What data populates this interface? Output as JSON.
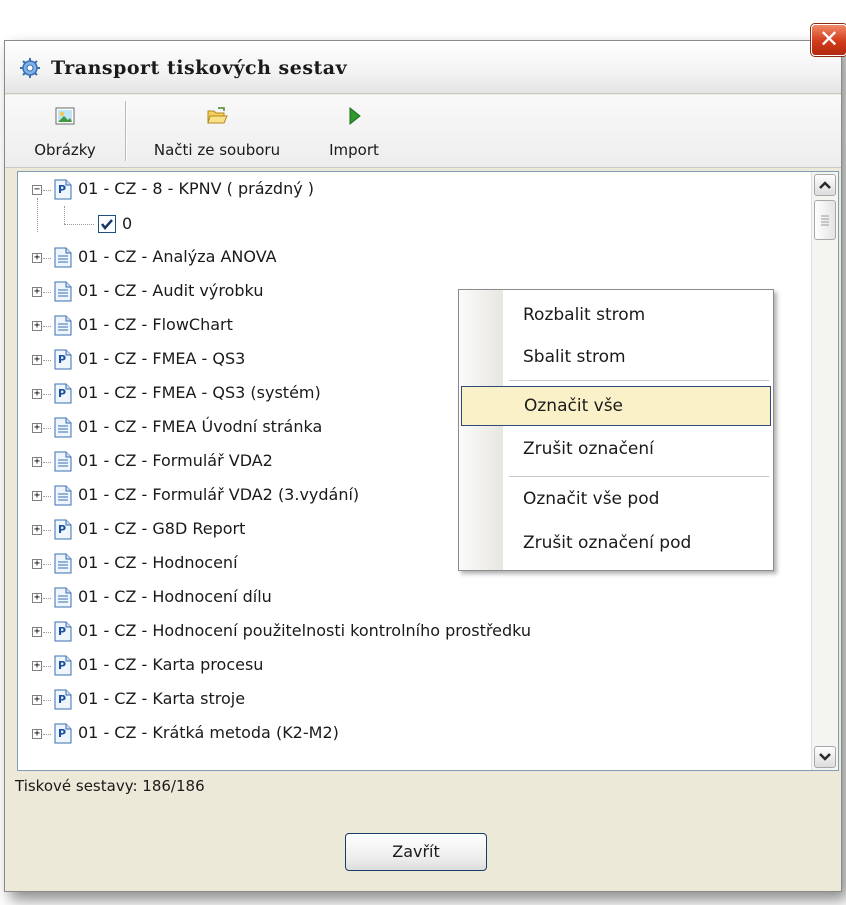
{
  "window": {
    "title": "Transport tiskových sestav",
    "close_glyph": "✕"
  },
  "toolbar": {
    "buttons": [
      {
        "label": "Obrázky",
        "icon": "image-icon"
      },
      {
        "label": "Načti ze souboru",
        "icon": "folder-open-icon"
      },
      {
        "label": "Import",
        "icon": "play-arrow-icon"
      }
    ]
  },
  "tree": {
    "items": [
      {
        "label": "01 - CZ - 8 - KPNV ( prázdný )",
        "expanded": true,
        "icon": "report-p-icon"
      },
      {
        "label": "01 - CZ - Analýza ANOVA",
        "expanded": false,
        "icon": "document-icon"
      },
      {
        "label": "01 - CZ - Audit výrobku",
        "expanded": false,
        "icon": "document-icon"
      },
      {
        "label": "01 - CZ - FlowChart",
        "expanded": false,
        "icon": "document-icon"
      },
      {
        "label": "01 - CZ - FMEA - QS3",
        "expanded": false,
        "icon": "report-p-icon"
      },
      {
        "label": "01 - CZ - FMEA - QS3 (systém)",
        "expanded": false,
        "icon": "report-p-icon"
      },
      {
        "label": "01 - CZ - FMEA Úvodní stránka",
        "expanded": false,
        "icon": "document-icon"
      },
      {
        "label": "01 - CZ - Formulář VDA2",
        "expanded": false,
        "icon": "document-icon"
      },
      {
        "label": "01 - CZ - Formulář VDA2 (3.vydání)",
        "expanded": false,
        "icon": "document-icon"
      },
      {
        "label": "01 - CZ - G8D Report",
        "expanded": false,
        "icon": "report-p-icon"
      },
      {
        "label": "01 - CZ - Hodnocení",
        "expanded": false,
        "icon": "document-icon"
      },
      {
        "label": "01 - CZ - Hodnocení dílu",
        "expanded": false,
        "icon": "document-icon"
      },
      {
        "label": "01 - CZ - Hodnocení použitelnosti kontrolního prostředku",
        "expanded": false,
        "icon": "report-p-icon"
      },
      {
        "label": "01 - CZ - Karta procesu",
        "expanded": false,
        "icon": "report-p-icon"
      },
      {
        "label": "01 - CZ - Karta stroje",
        "expanded": false,
        "icon": "report-p-icon"
      },
      {
        "label": "01 - CZ - Krátká metoda (K2-M2)",
        "expanded": false,
        "icon": "report-p-icon"
      }
    ],
    "child": {
      "label": "0",
      "checked": true
    }
  },
  "status": {
    "text": "Tiskové sestavy: 186/186"
  },
  "footer": {
    "close_label": "Zavřít"
  },
  "context_menu": {
    "items": [
      {
        "label": "Rozbalit strom",
        "selected": false
      },
      {
        "label": "Sbalit strom",
        "selected": false
      },
      {
        "label": "Označit vše",
        "selected": true
      },
      {
        "label": "Zrušit označení",
        "selected": false
      },
      {
        "label": "Označit vše pod",
        "selected": false
      },
      {
        "label": "Zrušit označení pod",
        "selected": false
      }
    ]
  },
  "colors": {
    "window_bg": "#ece9d8",
    "selection_bg": "#fbf1c8",
    "selection_border": "#2e4a7a",
    "close_red": "#d23a1a"
  }
}
